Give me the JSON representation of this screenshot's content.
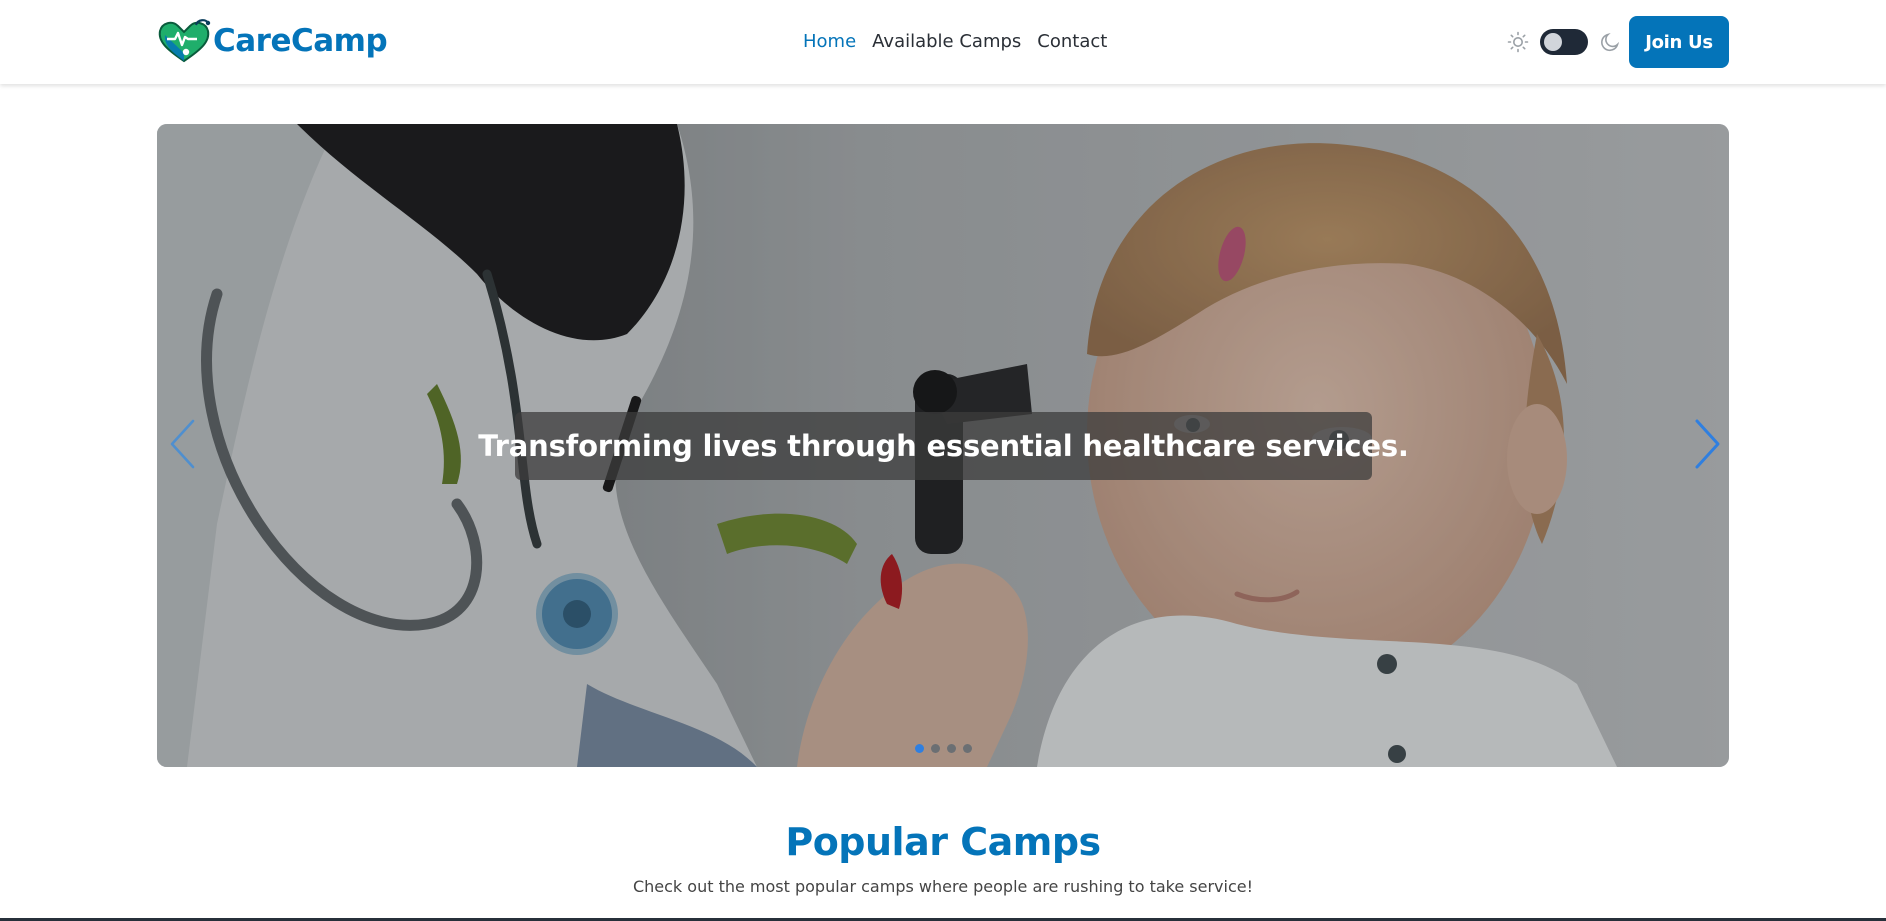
{
  "brand": {
    "name": "CareCamp",
    "color": "#0474b9",
    "icon": "heart-stethoscope-logo"
  },
  "nav": {
    "links": [
      {
        "label": "Home",
        "active": true
      },
      {
        "label": "Available Camps",
        "active": false
      },
      {
        "label": "Contact",
        "active": false
      }
    ]
  },
  "theme_toggle": {
    "light_icon": "sun-icon",
    "dark_icon": "moon-icon",
    "mode": "light"
  },
  "join_button": {
    "label": "Join Us"
  },
  "hero": {
    "caption": "Transforming lives through essential healthcare services.",
    "slide_count": 4,
    "active_slide": 1,
    "prev_icon": "chevron-left-icon",
    "next_icon": "chevron-right-icon",
    "image_subject": "doctor-examining-child-ear"
  },
  "popular": {
    "title": "Popular Camps",
    "subtitle": "Check out the most popular camps where people are rushing to take service!"
  },
  "colors": {
    "accent": "#0474b9",
    "carousel_arrow": "#2f7fe0",
    "dot_active": "#2f7fe0"
  }
}
